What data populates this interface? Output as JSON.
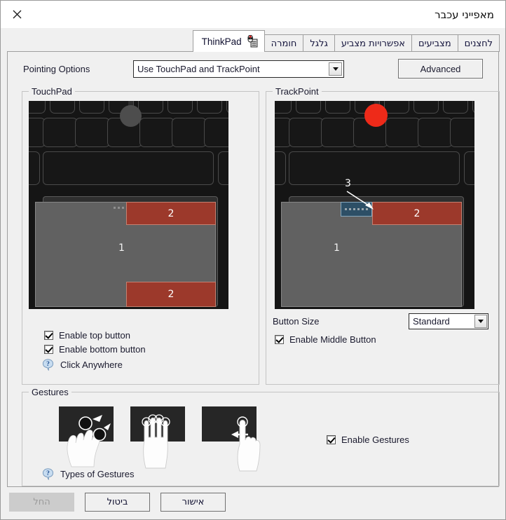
{
  "window": {
    "title": "מאפייני עכבר",
    "close_icon": "close-icon"
  },
  "tabs": [
    {
      "label": "לחצנים",
      "selected": false
    },
    {
      "label": "מצביעים",
      "selected": false
    },
    {
      "label": "אפשרויות מצביע",
      "selected": false
    },
    {
      "label": "גלגל",
      "selected": false
    },
    {
      "label": "חומרה",
      "selected": false
    },
    {
      "label": "ThinkPad",
      "selected": true,
      "icon": "thinkpad-mouse-icon"
    }
  ],
  "pointing": {
    "label": "Pointing Options",
    "selected_option": "Use TouchPad and TrackPoint",
    "options": [
      "Use TouchPad and TrackPoint"
    ],
    "advanced_button": "Advanced"
  },
  "touchpad": {
    "group_title": "TouchPad",
    "diagram": {
      "pad_label": "1",
      "top_button_label": "2",
      "bottom_button_label": "2"
    },
    "enable_top_button": {
      "label": "Enable top button",
      "checked": true
    },
    "enable_bottom_button": {
      "label": "Enable bottom button",
      "checked": true
    },
    "click_anywhere": {
      "label": "Click Anywhere",
      "icon": "help-question-icon"
    }
  },
  "trackpoint": {
    "group_title": "TrackPoint",
    "diagram": {
      "pad_label": "1",
      "right_button_label": "2",
      "middle_button_callout": "3"
    },
    "button_size": {
      "label": "Button Size",
      "selected_option": "Standard",
      "options": [
        "Standard"
      ]
    },
    "enable_middle_button": {
      "label": "Enable Middle Button",
      "checked": true
    }
  },
  "gestures": {
    "group_title": "Gestures",
    "images": [
      {
        "name": "pinch-zoom-gesture-image"
      },
      {
        "name": "three-finger-tap-gesture-image"
      },
      {
        "name": "one-finger-swipe-gesture-image"
      }
    ],
    "enable_gestures": {
      "label": "Enable Gestures",
      "checked": true
    },
    "types_of_gestures": {
      "label": "Types of Gestures",
      "icon": "help-question-icon"
    }
  },
  "footer": {
    "apply": "החל",
    "cancel": "ביטול",
    "ok": "אישור"
  },
  "colors": {
    "window_bg": "#f0f0f0",
    "titlebar_bg": "#ffffff",
    "illustration_bg": "#151515",
    "touchpad_gray": "#616161",
    "button_red": "#9c392b",
    "middle_button_blue": "#2d4f66",
    "trackpoint_nub_red": "#ee2a19",
    "trackpoint_nub_gray": "#4d4d4d"
  }
}
